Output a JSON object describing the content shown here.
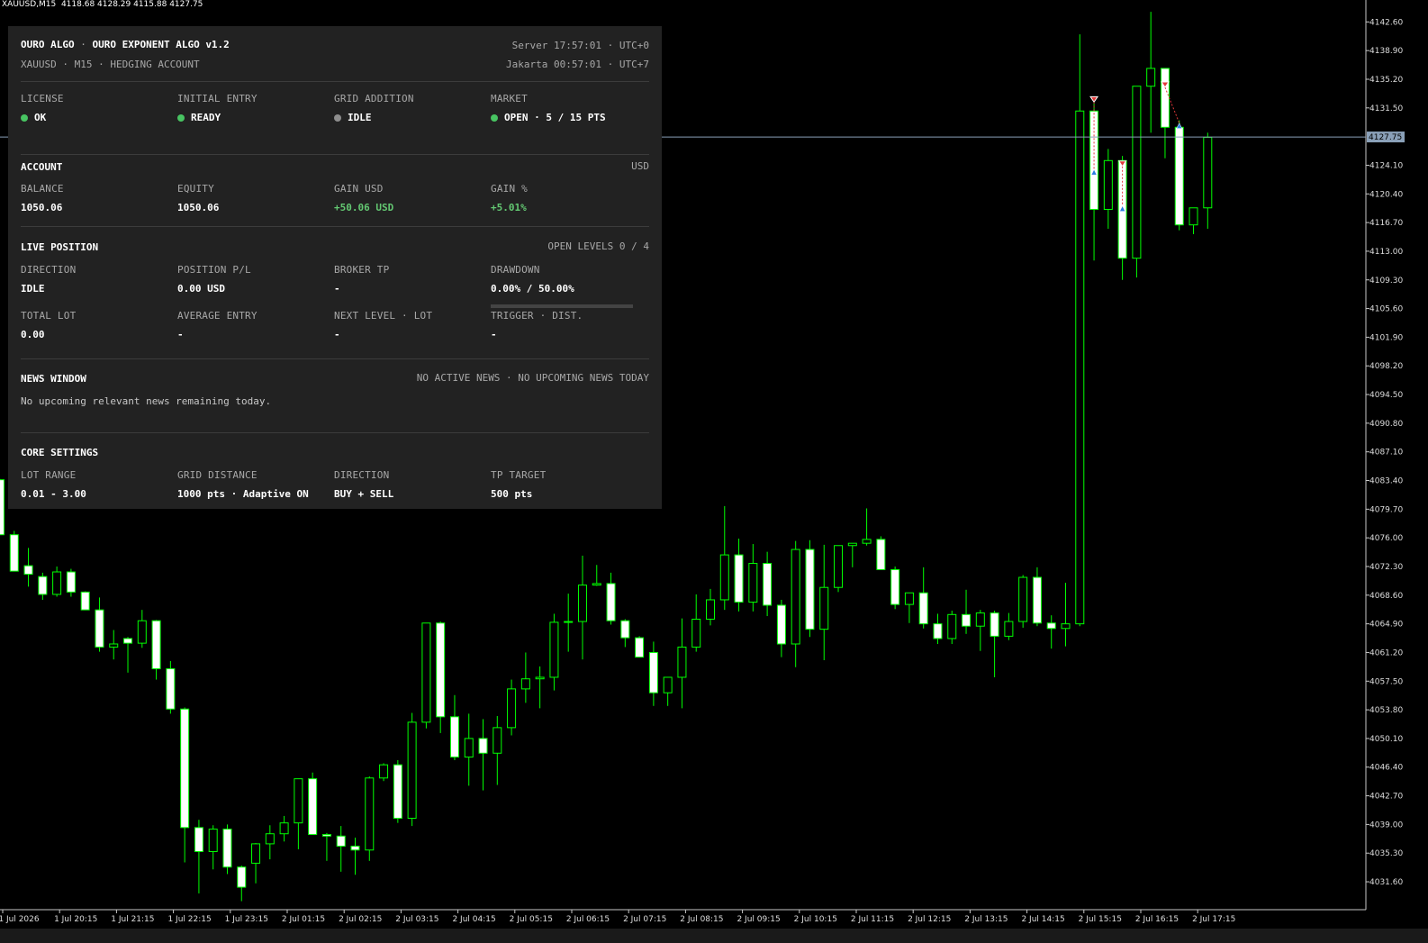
{
  "chart_header": {
    "symbol": "XAUUSD,M15",
    "ohlc": "4118.68 4128.29 4115.88 4127.75"
  },
  "panel": {
    "brand": "OURO ALGO",
    "title": "OURO EXPONENT ALGO v1.2",
    "subtitle": "XAUUSD · M15 · HEDGING ACCOUNT",
    "server_time": "Server 17:57:01 · UTC+0",
    "local_time": "Jakarta 00:57:01 · UTC+7",
    "status": [
      {
        "label": "LICENSE",
        "value": "OK",
        "active": true
      },
      {
        "label": "INITIAL ENTRY",
        "value": "READY",
        "active": true
      },
      {
        "label": "GRID ADDITION",
        "value": "IDLE",
        "active": false
      },
      {
        "label": "MARKET",
        "value": "OPEN · 5 / 15 PTS",
        "active": true
      }
    ],
    "account": {
      "title": "ACCOUNT",
      "currency": "USD",
      "fields": [
        {
          "label": "BALANCE",
          "value": "1050.06"
        },
        {
          "label": "EQUITY",
          "value": "1050.06"
        },
        {
          "label": "GAIN USD",
          "value": "+50.06 USD"
        },
        {
          "label": "GAIN %",
          "value": "+5.01%"
        }
      ]
    },
    "live": {
      "title": "LIVE POSITION",
      "levels": "OPEN LEVELS 0 / 4",
      "row1": [
        {
          "label": "DIRECTION",
          "value": "IDLE"
        },
        {
          "label": "POSITION P/L",
          "value": "0.00 USD"
        },
        {
          "label": "BROKER TP",
          "value": "-"
        },
        {
          "label": "DRAWDOWN",
          "value": "0.00% / 50.00%"
        }
      ],
      "drawdown_fraction": 0.0,
      "row2": [
        {
          "label": "TOTAL LOT",
          "value": "0.00"
        },
        {
          "label": "AVERAGE ENTRY",
          "value": "-"
        },
        {
          "label": "NEXT LEVEL · LOT",
          "value": "-"
        },
        {
          "label": "TRIGGER · DIST.",
          "value": "-"
        }
      ]
    },
    "news": {
      "title": "NEWS WINDOW",
      "status": "NO ACTIVE NEWS · NO UPCOMING NEWS TODAY",
      "message": "No upcoming relevant news remaining today."
    },
    "core": {
      "title": "CORE SETTINGS",
      "fields": [
        {
          "label": "LOT RANGE",
          "value": "0.01 - 3.00"
        },
        {
          "label": "GRID DISTANCE",
          "value": "1000 pts · Adaptive ON"
        },
        {
          "label": "DIRECTION",
          "value": "BUY + SELL"
        },
        {
          "label": "TP TARGET",
          "value": "500 pts"
        }
      ]
    }
  },
  "colors": {
    "background": "#000000",
    "candle_up_body": "#000000",
    "candle_down_body": "#ffffff",
    "wick": "#00ff00",
    "price_line": "#8aa0b8",
    "accent_green": "#63c872"
  },
  "chart_data": {
    "type": "candlestick",
    "symbol": "XAUUSD,M15",
    "current_price": "4127.75",
    "ylim": [
      4028.0,
      4144.5
    ],
    "y_ticks": [
      "4142.60",
      "4138.90",
      "4135.20",
      "4131.50",
      "4124.10",
      "4120.40",
      "4116.70",
      "4113.00",
      "4109.30",
      "4105.60",
      "4101.90",
      "4098.20",
      "4094.50",
      "4090.80",
      "4087.10",
      "4083.40",
      "4079.70",
      "4076.00",
      "4072.30",
      "4068.60",
      "4064.90",
      "4061.20",
      "4057.50",
      "4053.80",
      "4050.10",
      "4046.40",
      "4042.70",
      "4039.00",
      "4035.30",
      "4031.60"
    ],
    "x_ticks": [
      "1 Jul 2026",
      "1 Jul 20:15",
      "1 Jul 21:15",
      "1 Jul 22:15",
      "1 Jul 23:15",
      "2 Jul 01:15",
      "2 Jul 02:15",
      "2 Jul 03:15",
      "2 Jul 04:15",
      "2 Jul 05:15",
      "2 Jul 06:15",
      "2 Jul 07:15",
      "2 Jul 08:15",
      "2 Jul 09:15",
      "2 Jul 10:15",
      "2 Jul 11:15",
      "2 Jul 12:15",
      "2 Jul 13:15",
      "2 Jul 14:15",
      "2 Jul 15:15",
      "2 Jul 16:15",
      "2 Jul 17:15"
    ],
    "candles": [
      [
        4083.5,
        4083.6,
        4076.6,
        4076.4
      ],
      [
        4076.4,
        4076.9,
        4072.5,
        4071.7
      ],
      [
        4072.4,
        4074.7,
        4069.7,
        4071.3
      ],
      [
        4071.0,
        4071.5,
        4068.0,
        4068.7
      ],
      [
        4068.7,
        4072.3,
        4068.4,
        4071.6
      ],
      [
        4071.6,
        4072.0,
        4068.4,
        4069.0
      ],
      [
        4069.0,
        4069.1,
        4067.4,
        4066.7
      ],
      [
        4066.7,
        4068.3,
        4061.3,
        4061.9
      ],
      [
        4061.9,
        4064.1,
        4060.3,
        4062.3
      ],
      [
        4063.0,
        4063.2,
        4058.6,
        4062.4
      ],
      [
        4062.4,
        4066.7,
        4061.8,
        4065.3
      ],
      [
        4065.3,
        4065.4,
        4057.7,
        4059.1
      ],
      [
        4059.1,
        4060.1,
        4053.3,
        4053.9
      ],
      [
        4053.9,
        4054.1,
        4034.1,
        4038.6
      ],
      [
        4038.6,
        4039.6,
        4030.1,
        4035.5
      ],
      [
        4035.5,
        4038.9,
        4033.2,
        4038.4
      ],
      [
        4038.4,
        4039.0,
        4032.6,
        4033.5
      ],
      [
        4033.5,
        4033.7,
        4029.1,
        4030.9
      ],
      [
        4034.0,
        4036.6,
        4031.4,
        4036.5
      ],
      [
        4036.5,
        4038.9,
        4034.5,
        4037.8
      ],
      [
        4037.8,
        4040.1,
        4036.8,
        4039.2
      ],
      [
        4039.2,
        4040.3,
        4035.8,
        4044.9
      ],
      [
        4044.9,
        4045.7,
        4038.9,
        4037.7
      ],
      [
        4037.7,
        4037.9,
        4034.3,
        4037.5
      ],
      [
        4037.5,
        4038.8,
        4032.9,
        4036.2
      ],
      [
        4036.2,
        4037.3,
        4032.5,
        4035.7
      ],
      [
        4035.7,
        4045.2,
        4034.3,
        4045.0
      ],
      [
        4045.0,
        4046.9,
        4044.6,
        4046.7
      ],
      [
        4046.7,
        4047.3,
        4039.2,
        4039.8
      ],
      [
        4039.8,
        4053.4,
        4038.8,
        4052.2
      ],
      [
        4052.2,
        4064.6,
        4051.4,
        4065.0
      ],
      [
        4065.0,
        4065.2,
        4050.8,
        4052.9
      ],
      [
        4052.9,
        4055.7,
        4047.3,
        4047.7
      ],
      [
        4047.7,
        4053.3,
        4044.0,
        4050.1
      ],
      [
        4050.1,
        4052.6,
        4043.4,
        4048.2
      ],
      [
        4048.2,
        4053.0,
        4044.1,
        4051.5
      ],
      [
        4051.5,
        4057.7,
        4050.5,
        4056.5
      ],
      [
        4056.5,
        4061.2,
        4054.7,
        4057.8
      ],
      [
        4057.8,
        4059.4,
        4054.0,
        4058.0
      ],
      [
        4058.0,
        4066.2,
        4056.3,
        4065.1
      ],
      [
        4065.1,
        4068.8,
        4061.3,
        4065.2
      ],
      [
        4065.2,
        4073.7,
        4060.3,
        4069.9
      ],
      [
        4069.9,
        4072.5,
        4069.8,
        4070.1
      ],
      [
        4070.1,
        4071.5,
        4064.8,
        4065.3
      ],
      [
        4065.3,
        4065.5,
        4061.9,
        4063.1
      ],
      [
        4063.1,
        4063.3,
        4060.6,
        4060.6
      ],
      [
        4061.2,
        4062.6,
        4054.3,
        4056.0
      ],
      [
        4056.0,
        4057.8,
        4054.3,
        4058.0
      ],
      [
        4058.0,
        4065.6,
        4054.0,
        4061.9
      ],
      [
        4061.9,
        4068.7,
        4061.3,
        4065.5
      ],
      [
        4065.5,
        4069.4,
        4064.7,
        4068.0
      ],
      [
        4068.0,
        4080.1,
        4066.7,
        4073.8
      ],
      [
        4073.8,
        4075.9,
        4066.5,
        4067.7
      ],
      [
        4067.7,
        4075.2,
        4066.5,
        4072.7
      ],
      [
        4072.7,
        4074.2,
        4065.9,
        4067.3
      ],
      [
        4067.3,
        4068.0,
        4060.6,
        4062.3
      ],
      [
        4062.3,
        4075.6,
        4059.3,
        4074.5
      ],
      [
        4074.5,
        4075.7,
        4063.2,
        4064.2
      ],
      [
        4064.2,
        4075.1,
        4060.2,
        4069.6
      ],
      [
        4069.6,
        4074.2,
        4069.0,
        4075.0
      ],
      [
        4075.0,
        4075.2,
        4072.2,
        4075.3
      ],
      [
        4075.3,
        4079.8,
        4075.0,
        4075.8
      ],
      [
        4075.8,
        4076.2,
        4072.1,
        4071.9
      ],
      [
        4071.9,
        4072.3,
        4066.8,
        4067.4
      ],
      [
        4067.4,
        4068.6,
        4065.0,
        4068.9
      ],
      [
        4068.9,
        4072.2,
        4064.3,
        4064.9
      ],
      [
        4064.9,
        4066.2,
        4062.3,
        4063.0
      ],
      [
        4063.0,
        4066.6,
        4062.3,
        4066.1
      ],
      [
        4066.1,
        4069.3,
        4063.6,
        4064.6
      ],
      [
        4064.6,
        4066.7,
        4061.4,
        4066.3
      ],
      [
        4066.3,
        4066.6,
        4058.0,
        4063.3
      ],
      [
        4063.3,
        4066.3,
        4062.8,
        4065.2
      ],
      [
        4065.2,
        4071.2,
        4064.4,
        4070.9
      ],
      [
        4070.9,
        4072.2,
        4064.6,
        4065.0
      ],
      [
        4065.0,
        4066.0,
        4061.7,
        4064.3
      ],
      [
        4064.3,
        4070.2,
        4062.0,
        4064.9
      ],
      [
        4064.9,
        4141.0,
        4064.6,
        4131.1
      ],
      [
        4131.1,
        4132.6,
        4111.8,
        4118.4
      ],
      [
        4118.4,
        4126.2,
        4115.9,
        4124.7
      ],
      [
        4124.7,
        4125.3,
        4109.3,
        4112.1
      ],
      [
        4112.1,
        4133.7,
        4109.6,
        4134.3
      ],
      [
        4134.3,
        4143.9,
        4128.3,
        4136.6
      ],
      [
        4136.6,
        4134.9,
        4125.0,
        4129.0
      ],
      [
        4129.0,
        4129.9,
        4115.7,
        4116.4
      ],
      [
        4116.4,
        4118.6,
        4115.2,
        4118.6
      ],
      [
        4118.6,
        4128.3,
        4115.9,
        4127.7
      ]
    ],
    "markers": [
      {
        "candle": 77,
        "type": "sell",
        "price": 4132.6
      },
      {
        "candle": 77,
        "type": "buy",
        "price": 4123.2
      },
      {
        "candle": 79,
        "type": "sell",
        "price": 4124.3
      },
      {
        "candle": 79,
        "type": "buy",
        "price": 4118.5
      },
      {
        "candle": 82,
        "type": "sell",
        "price": 4134.5
      },
      {
        "candle": 83,
        "type": "buy",
        "price": 4129.2
      }
    ]
  }
}
